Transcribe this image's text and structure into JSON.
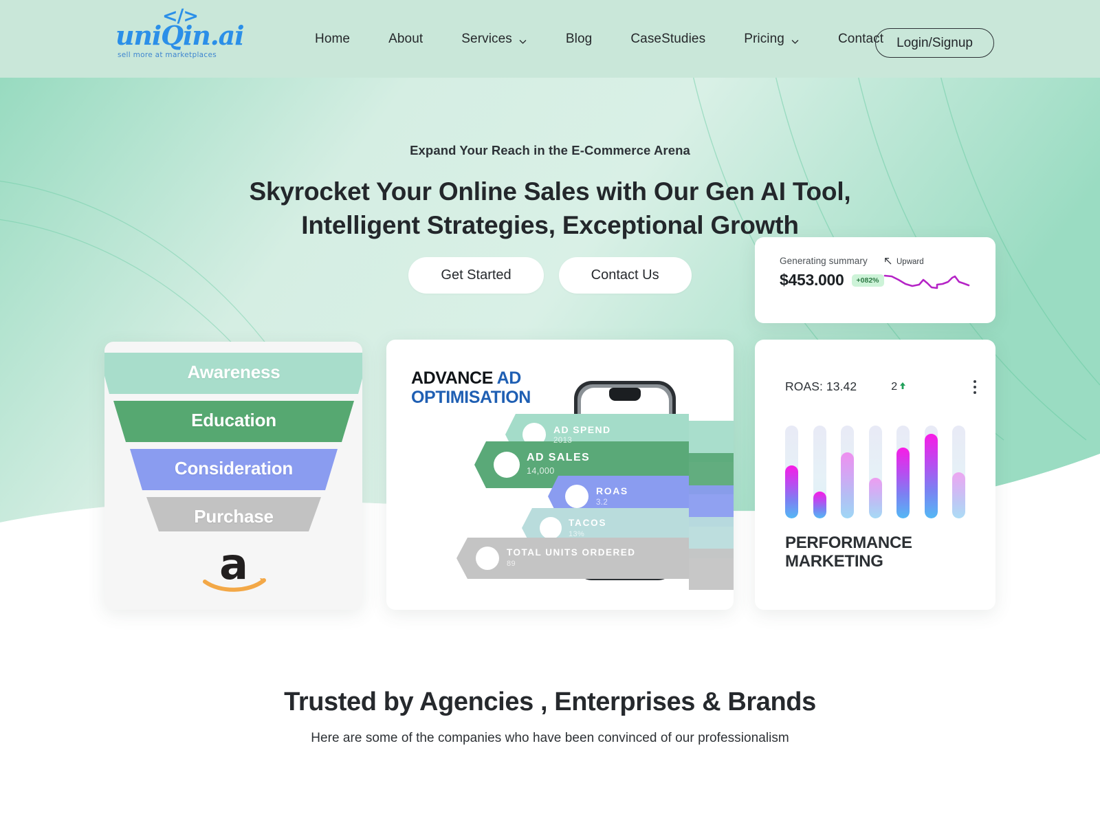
{
  "brand": {
    "logo_code": "</>",
    "logo_name": "uniQin.ai",
    "tagline": "sell more at marketplaces",
    "accent_blue": "#2b8fe8"
  },
  "header": {
    "nav": [
      {
        "label": "Home",
        "has_chevron": false
      },
      {
        "label": "About",
        "has_chevron": false
      },
      {
        "label": "Services",
        "has_chevron": true
      },
      {
        "label": "Blog",
        "has_chevron": false
      },
      {
        "label": "CaseStudies",
        "has_chevron": false
      },
      {
        "label": "Pricing",
        "has_chevron": true
      },
      {
        "label": "Contact",
        "has_chevron": false
      }
    ],
    "login_label": "Login/Signup",
    "background": "#c9e7d9"
  },
  "hero": {
    "kicker": "Expand Your Reach in the E-Commerce Arena",
    "headline_line1": "Skyrocket Your Online Sales with Our Gen AI Tool,",
    "headline_line2": "Intelligent Strategies, Exceptional Growth",
    "primary_cta": "Get Started",
    "secondary_cta": "Contact Us",
    "background_top": "#c9e7d9",
    "background_mid": "#93d9bd"
  },
  "summary_card": {
    "label": "Generating summary",
    "value": "$453.000",
    "badge": "+082%",
    "trend_label": "Upward",
    "line_color": "#b524c6"
  },
  "funnel_card": {
    "stages": [
      {
        "label": "Awareness",
        "color": "#a8ddcb"
      },
      {
        "label": "Education",
        "color": "#56a871"
      },
      {
        "label": "Consideration",
        "color": "#8a9cf0"
      },
      {
        "label": "Purchase",
        "color": "#c2c2c2"
      }
    ],
    "logo_alt": "amazon"
  },
  "ad_card": {
    "title_dark": "ADVANCE",
    "title_blue_inline": "AD",
    "title_blue_line2": "OPTIMISATION",
    "metrics": [
      {
        "label": "AD SPEND",
        "value": "2013",
        "color": "#a4dcc9"
      },
      {
        "label": "AD SALES",
        "value": "14,000",
        "color": "#5aa978"
      },
      {
        "label": "ROAS",
        "value": "3.2",
        "color": "#8a9cf0"
      },
      {
        "label": "TACOS",
        "value": "13%",
        "color": "#b9dcdc"
      },
      {
        "label": "TOTAL UNITS ORDERED",
        "value": "89",
        "color": "#c4c4c4"
      }
    ]
  },
  "performance_card": {
    "roas_label": "ROAS: 13.42",
    "delta": "2",
    "delta_arrow": "up",
    "title_line1": "PERFORMANCE",
    "title_line2": "MARKETING",
    "menu": "kebab-menu",
    "bars": [
      {
        "fill_pct": 57
      },
      {
        "fill_pct": 29
      },
      {
        "fill_pct": 71
      },
      {
        "fill_pct": 44
      },
      {
        "fill_pct": 76
      },
      {
        "fill_pct": 91
      },
      {
        "fill_pct": 50
      }
    ]
  },
  "trusted": {
    "title": "Trusted by Agencies , Enterprises & Brands",
    "subtitle": "Here are some of the companies who have been convinced of our professionalism"
  }
}
